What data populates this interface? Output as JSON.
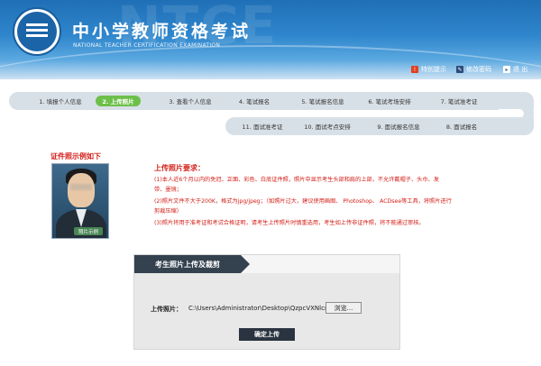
{
  "header": {
    "title": "中小学教师资格考试",
    "subtitle": "NATIONAL TEACHER CERTIFICATION EXAMINATION",
    "watermark": "NTCE",
    "links": {
      "tips": "特别提示",
      "change_password": "修改密码",
      "exit": "退 出"
    }
  },
  "steps_row1": [
    {
      "label": "1. 填报个人信息",
      "active": false
    },
    {
      "label": "2. 上传照片",
      "active": true
    },
    {
      "label": "3. 查看个人信息",
      "active": false
    },
    {
      "label": "4. 笔试报名",
      "active": false
    },
    {
      "label": "5. 笔试报名信息",
      "active": false
    },
    {
      "label": "6. 笔试考场安排",
      "active": false
    },
    {
      "label": "7. 笔试准考证",
      "active": false
    }
  ],
  "steps_row2": [
    {
      "label": "11. 面试准考证",
      "active": false
    },
    {
      "label": "10. 面试考点安排",
      "active": false
    },
    {
      "label": "9. 面试报名信息",
      "active": false
    },
    {
      "label": "8. 面试报名",
      "active": false
    }
  ],
  "example": {
    "title": "证件照示例如下",
    "photo_label": "照片示例"
  },
  "requirements": {
    "title": "上传照片要求：",
    "items": [
      "(1)本人近6个月以内的免冠、正面、彩色、白底证件照，照片中显示考生头部和肩的上部，不允许戴帽子、头巾、发",
      "带、墨镜；",
      "(2)照片文件不大于200K，格式为jpg/jpeg；（如照片过大，建议使用画图、 Photoshop、 ACDsee等工具，将照片进行",
      "剪裁压缩）",
      "(3)照片将用于准考证和考试合格证明，请考生上传照片时慎重选用，考生如上传非证件照，将不能通过审核。"
    ]
  },
  "upload": {
    "tab_title": "考生照片上传及裁剪",
    "field_label": "上传照片：",
    "file_path": "C:\\Users\\Administrator\\Desktop\\QzpcVXNlcnf",
    "browse_label": "浏览...",
    "submit_label": "确定上传"
  },
  "colors": {
    "header_blue": "#2f86cc",
    "active_step": "#6cc04a",
    "warning_red": "#d4201a",
    "dark_button": "#2a3440"
  }
}
